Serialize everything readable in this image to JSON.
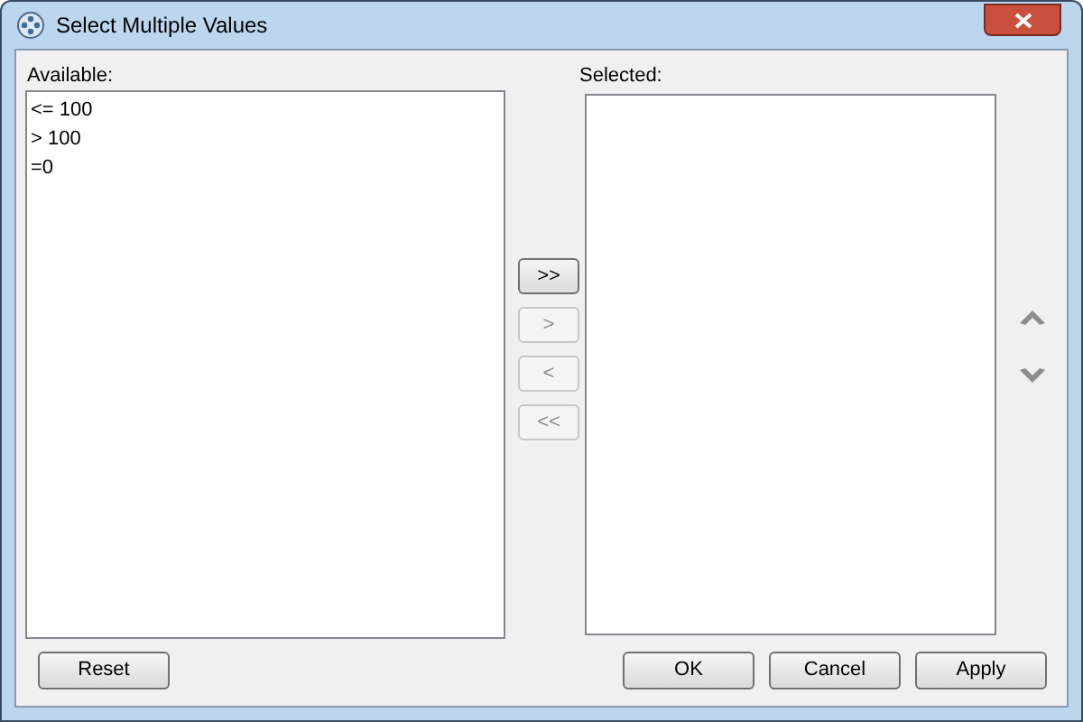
{
  "window": {
    "title": "Select Multiple Values"
  },
  "available": {
    "label": "Available:",
    "items": [
      "<= 100",
      "> 100",
      "=0"
    ]
  },
  "selected": {
    "label": "Selected:"
  },
  "transfer_buttons": [
    {
      "label": ">>",
      "disabled": false
    },
    {
      "label": ">",
      "disabled": true
    },
    {
      "label": "<",
      "disabled": true
    },
    {
      "label": "<<",
      "disabled": true
    }
  ],
  "footer": {
    "left": [
      "Reset"
    ],
    "right": [
      "OK",
      "Cancel",
      "Apply"
    ]
  }
}
